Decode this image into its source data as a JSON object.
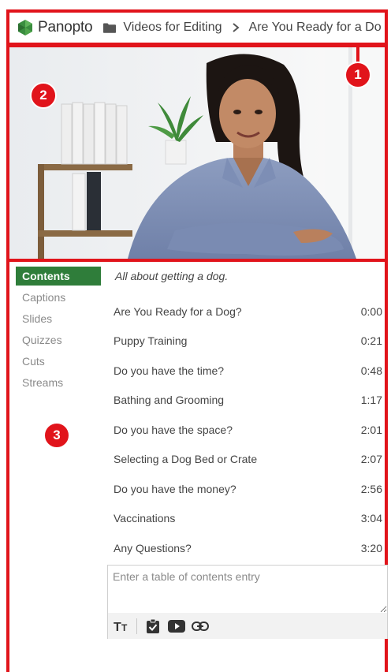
{
  "header": {
    "brand": "Panopto",
    "folder_label": "Videos for Editing",
    "current_title": "Are You Ready for a Do"
  },
  "badges": {
    "header": "1",
    "video": "2",
    "panel": "3"
  },
  "sidenav": {
    "items": [
      {
        "label": "Contents",
        "active": true
      },
      {
        "label": "Captions"
      },
      {
        "label": "Slides"
      },
      {
        "label": "Quizzes"
      },
      {
        "label": "Cuts"
      },
      {
        "label": "Streams"
      }
    ]
  },
  "toc": {
    "heading": "All about getting a dog.",
    "entries": [
      {
        "title": "Are You Ready for a Dog?",
        "time": "0:00"
      },
      {
        "title": "Puppy Training",
        "time": "0:21"
      },
      {
        "title": "Do you have the time?",
        "time": "0:48"
      },
      {
        "title": "Bathing and Grooming",
        "time": "1:17"
      },
      {
        "title": "Do you have the space?",
        "time": "2:01"
      },
      {
        "title": "Selecting a Dog Bed or Crate",
        "time": "2:07"
      },
      {
        "title": "Do you have the money?",
        "time": "2:56"
      },
      {
        "title": "Vaccinations",
        "time": "3:04"
      },
      {
        "title": "Any Questions?",
        "time": "3:20"
      }
    ],
    "entry_placeholder": "Enter a table of contents entry",
    "toolbar_icons": [
      "text-format-icon",
      "checklist-icon",
      "youtube-icon",
      "link-icon"
    ]
  },
  "colors": {
    "annotation_red": "#e1141b",
    "active_tab_green": "#2f7d3a",
    "brand_green": "#3a8d3f"
  }
}
